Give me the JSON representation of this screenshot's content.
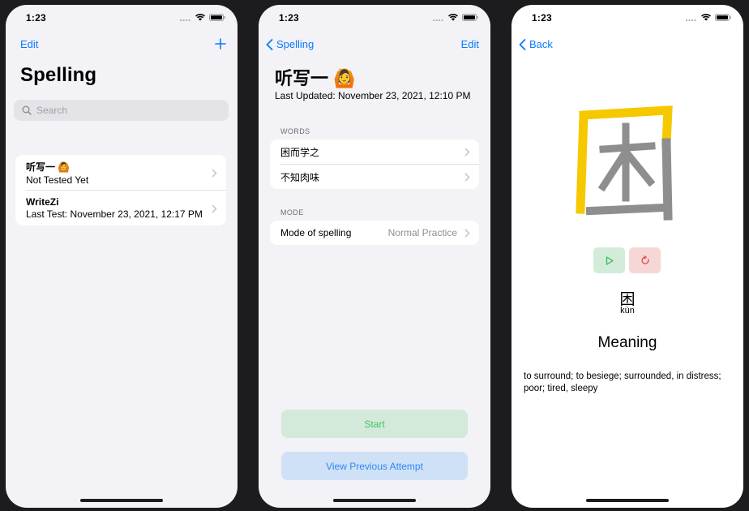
{
  "status_time": "1:23",
  "list_screen": {
    "nav_edit": "Edit",
    "nav_add_icon": "plus-icon",
    "title": "Spelling",
    "search_placeholder": "Search",
    "items": [
      {
        "title": "听写一 🙆",
        "subtitle": "Not Tested Yet"
      },
      {
        "title": "WriteZi",
        "subtitle": "Last Test: November 23, 2021, 12:17 PM"
      }
    ]
  },
  "detail_screen": {
    "back_label": "Spelling",
    "edit_label": "Edit",
    "title": "听写一 🙆",
    "last_updated": "Last Updated: November 23, 2021, 12:10 PM",
    "words_header": "WORDS",
    "words": [
      "困而学之",
      "不知肉味"
    ],
    "mode_header": "MODE",
    "mode_label": "Mode of spelling",
    "mode_value": "Normal Practice",
    "start_label": "Start",
    "previous_label": "View Previous Attempt"
  },
  "practice_screen": {
    "back_label": "Back",
    "character": "困",
    "pinyin": "kùn",
    "meaning_title": "Meaning",
    "meaning_text": "to surround; to besiege; surrounded, in distress; poor; tired, sleepy"
  },
  "colors": {
    "accent": "#0a7aff",
    "start_bg": "#d3eadb",
    "start_text": "#43c265",
    "previous_bg": "#cfe1f6",
    "previous_text": "#2f86f2",
    "stroke_done": "#f5c800",
    "stroke_pending": "#8e8e8e"
  }
}
